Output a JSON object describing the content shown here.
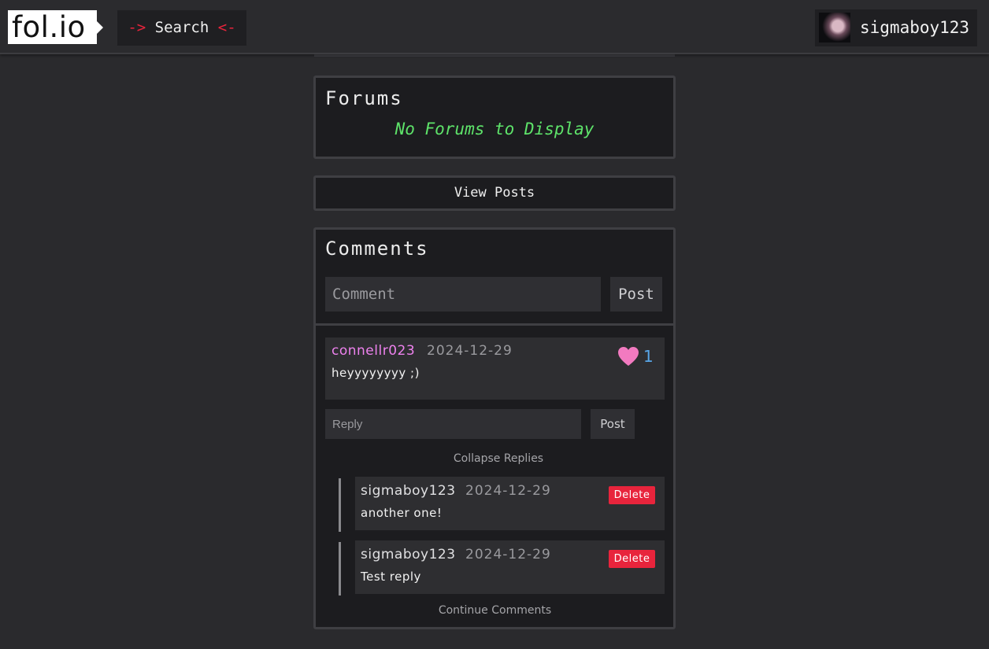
{
  "header": {
    "logo_text": "fol.io",
    "search": {
      "arrow_left": "->",
      "label": "Search",
      "arrow_right": "<-"
    },
    "user": {
      "username": "sigmaboy123"
    }
  },
  "forums": {
    "title": "Forums",
    "empty_message": "No Forums to Display"
  },
  "view_posts_label": "View Posts",
  "comments": {
    "title": "Comments",
    "input_placeholder": "Comment",
    "post_label": "Post",
    "items": [
      {
        "author": "connellr023",
        "date": "2024-12-29",
        "body": "heyyyyyyyy ;)",
        "likes": "1",
        "reply_placeholder": "Reply",
        "reply_post_label": "Post",
        "collapse_label": "Collapse Replies",
        "replies": [
          {
            "author": "sigmaboy123",
            "date": "2024-12-29",
            "body": "another one!",
            "delete_label": "Delete"
          },
          {
            "author": "sigmaboy123",
            "date": "2024-12-29",
            "body": "Test reply",
            "delete_label": "Delete"
          }
        ]
      }
    ],
    "continue_label": "Continue Comments"
  },
  "colors": {
    "accent_red": "#e8243c",
    "success_green": "#5ee36a",
    "author_pink": "#ee82ee",
    "like_blue": "#58a6e8",
    "heart_pink": "#f27ac0"
  },
  "icons": {
    "like": "heart-icon",
    "avatar": "user-avatar"
  }
}
